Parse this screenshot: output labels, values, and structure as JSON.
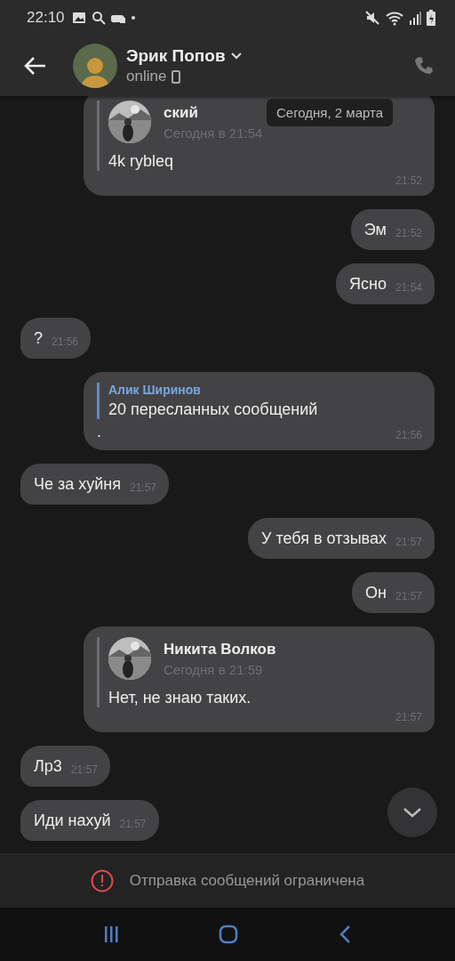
{
  "status_bar": {
    "time": "22:10"
  },
  "header": {
    "name": "Эрик Попов",
    "status": "online"
  },
  "date_tooltip": "Сегодня, 2 марта",
  "messages": [
    {
      "kind": "forward",
      "outgoing": true,
      "author": "ский",
      "author_time": "Сегодня в 21:54",
      "text": "4k rybleq",
      "time": "21:52"
    },
    {
      "kind": "text",
      "outgoing": true,
      "text": "Эм",
      "time": "21:52"
    },
    {
      "kind": "text",
      "outgoing": true,
      "text": "Ясно",
      "time": "21:54"
    },
    {
      "kind": "text",
      "outgoing": false,
      "text": "?",
      "time": "21:56"
    },
    {
      "kind": "forward_count",
      "outgoing": true,
      "author": "Алик Ширинов",
      "text": "20 пересланных сообщений",
      "caption": ".",
      "time": "21:56"
    },
    {
      "kind": "text",
      "outgoing": false,
      "text": "Че за хуйня",
      "time": "21:57"
    },
    {
      "kind": "text",
      "outgoing": true,
      "text": "У тебя в отзывах",
      "time": "21:57"
    },
    {
      "kind": "text",
      "outgoing": true,
      "text": "Он",
      "time": "21:57"
    },
    {
      "kind": "forward",
      "outgoing": true,
      "author": "Никита Волков",
      "author_time": "Сегодня в 21:59",
      "text": "Нет, не знаю таких.",
      "time": "21:57"
    },
    {
      "kind": "text",
      "outgoing": false,
      "text": "Лр3",
      "time": "21:57"
    },
    {
      "kind": "text",
      "outgoing": false,
      "text": "Иди нахуй",
      "time": "21:57"
    }
  ],
  "notice": "Отправка сообщений ограничена"
}
